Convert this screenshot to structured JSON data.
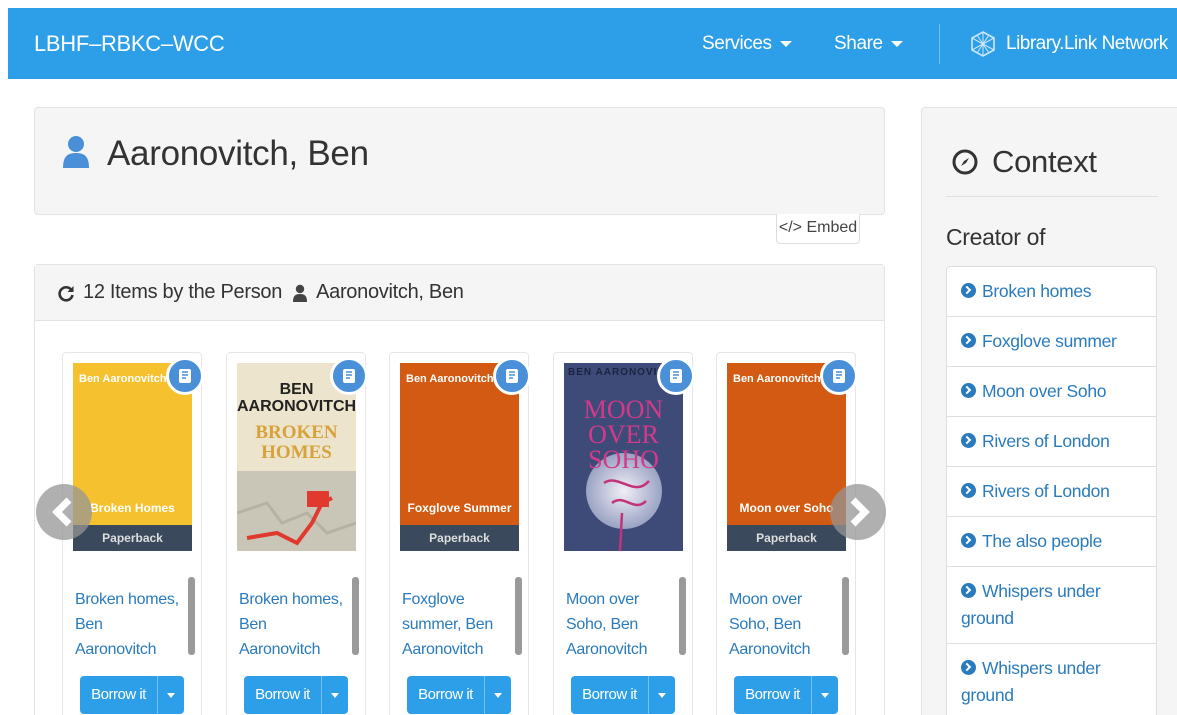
{
  "header": {
    "brand": "LBHF–RBKC–WCC",
    "services": "Services",
    "share": "Share",
    "network": "Library.Link Network"
  },
  "person": {
    "name": "Aaronovitch, Ben",
    "embed": "</> Embed"
  },
  "items": {
    "heading_count": "12 Items by the Person",
    "heading_person": "Aaronovitch, Ben",
    "cards": [
      {
        "cover_author": "Ben Aaronovitch",
        "cover_title": "Broken Homes",
        "format": "Paperback",
        "title": "Broken homes, Ben Aaronovitch",
        "borrow": "Borrow it",
        "color": "#f5c12e"
      },
      {
        "cover_author": "BEN AARONOVITCH",
        "cover_title": "BROKEN HOMES",
        "format": "",
        "title": "Broken homes, Ben Aaronovitch",
        "borrow": "Borrow it",
        "color": "#e8e0c8"
      },
      {
        "cover_author": "Ben Aaronovitch",
        "cover_title": "Foxglove Summer",
        "format": "Paperback",
        "title": "Foxglove summer, Ben Aaronovitch",
        "borrow": "Borrow it",
        "color": "#d25a12"
      },
      {
        "cover_author": "BEN AARONOVITCH",
        "cover_title": "MOON OVER SOHO",
        "format": "",
        "title": "Moon over Soho, Ben Aaronovitch",
        "borrow": "Borrow it",
        "color": "#4a5a86"
      },
      {
        "cover_author": "Ben Aaronovitch",
        "cover_title": "Moon over Soho",
        "format": "Paperback",
        "title": "Moon over Soho, Ben Aaronovitch",
        "borrow": "Borrow it",
        "color": "#d25a12"
      }
    ]
  },
  "sidebar": {
    "title": "Context",
    "subtitle": "Creator of",
    "links": [
      "Broken homes",
      "Foxglove summer",
      "Moon over Soho",
      "Rivers of London",
      "Rivers of London",
      "The also people",
      "Whispers under ground",
      "Whispers under ground"
    ]
  },
  "colors": {
    "accent": "#2d9ee8",
    "link": "#2a7bbd"
  }
}
